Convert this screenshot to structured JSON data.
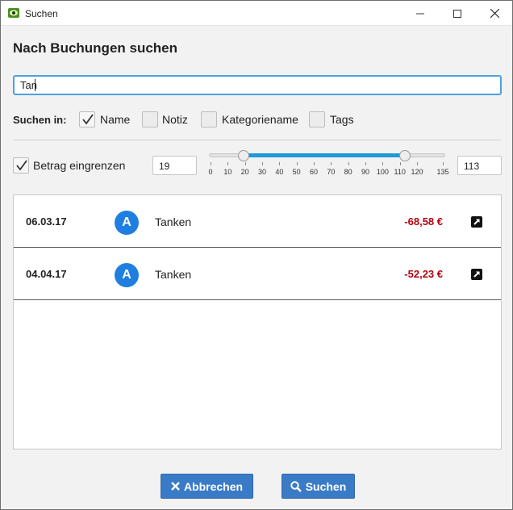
{
  "window": {
    "title": "Suchen"
  },
  "heading": "Nach Buchungen suchen",
  "search": {
    "value": "Tan",
    "placeholder": ""
  },
  "search_in": {
    "label": "Suchen in:",
    "options": [
      {
        "label": "Name",
        "checked": true
      },
      {
        "label": "Notiz",
        "checked": false
      },
      {
        "label": "Kategoriename",
        "checked": false
      },
      {
        "label": "Tags",
        "checked": false
      }
    ]
  },
  "amount_filter": {
    "label": "Betrag eingrenzen",
    "checked": true,
    "min_value": "19",
    "max_value": "113",
    "slider_min": 0,
    "slider_max": 135,
    "range_low": 19,
    "range_high": 113,
    "ticks": [
      "0",
      "10",
      "20",
      "30",
      "40",
      "50",
      "60",
      "70",
      "80",
      "90",
      "100",
      "110",
      "120",
      "135"
    ]
  },
  "results": [
    {
      "date": "06.03.17",
      "avatar": "A",
      "name": "Tanken",
      "amount": "-68,58 €",
      "icon": "open-external-icon"
    },
    {
      "date": "04.04.17",
      "avatar": "A",
      "name": "Tanken",
      "amount": "-52,23 €",
      "icon": "open-external-icon"
    }
  ],
  "buttons": {
    "cancel_label": "Abbrechen",
    "search_label": "Suchen"
  },
  "colors": {
    "accent": "#1f9ad6",
    "button": "#3a7bc8",
    "negative_amount": "#b3000d",
    "avatar": "#1e7fe0"
  }
}
